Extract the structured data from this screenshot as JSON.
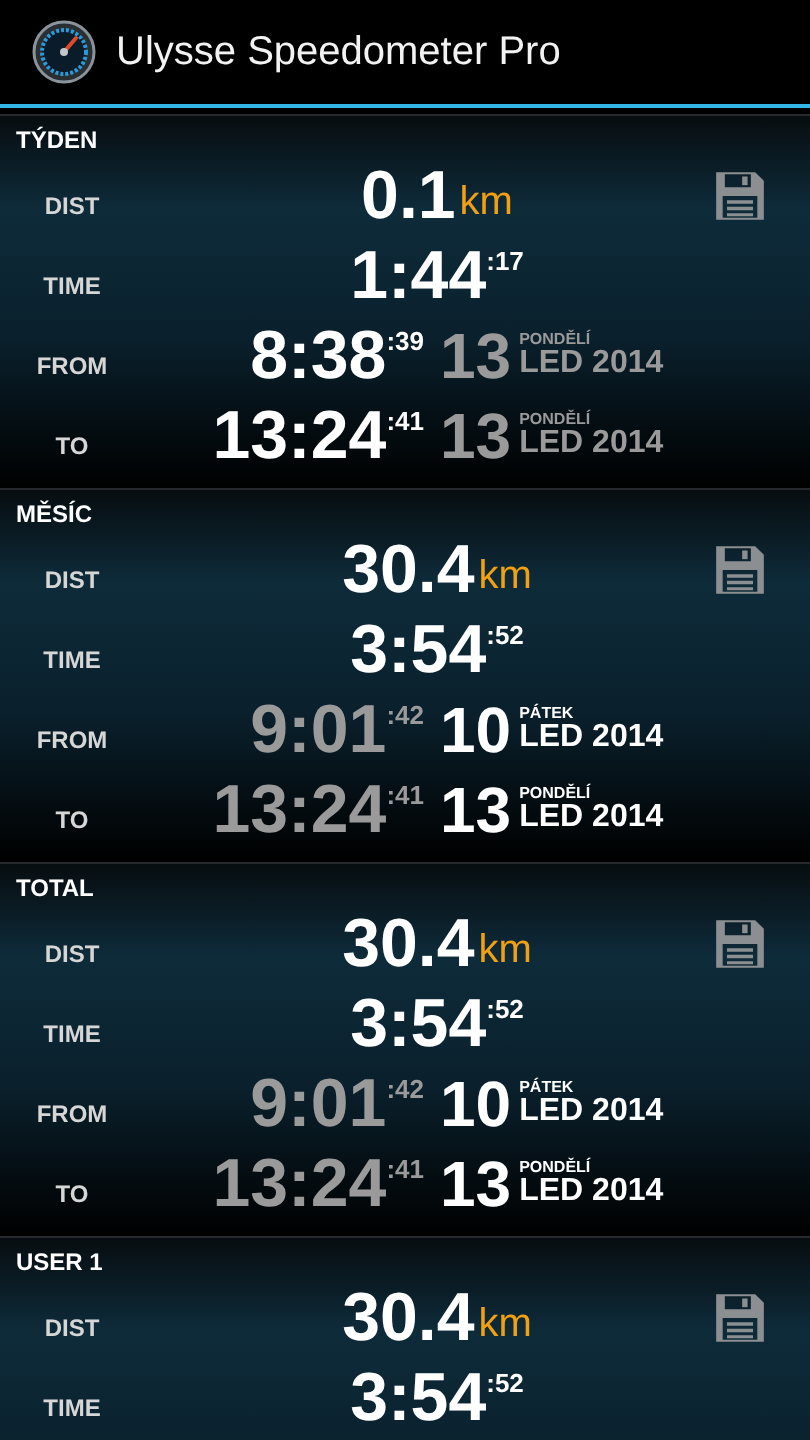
{
  "app_bar": {
    "title": "Ulysse Speedometer Pro"
  },
  "sections": [
    {
      "title": "TÝDEN",
      "dist": {
        "label": "DIST",
        "value": "0.1",
        "unit": "km"
      },
      "time": {
        "label": "TIME",
        "value": "1:44",
        "seconds": ":17"
      },
      "from": {
        "label": "FROM",
        "time": "8:38",
        "seconds": ":39",
        "time_dim": false,
        "day": "13",
        "weekday": "PONDĚLÍ",
        "month_year": "LED 2014",
        "date_dim": true
      },
      "to": {
        "label": "TO",
        "time": "13:24",
        "seconds": ":41",
        "time_dim": false,
        "day": "13",
        "weekday": "PONDĚLÍ",
        "month_year": "LED 2014",
        "date_dim": true
      }
    },
    {
      "title": "MĚSÍC",
      "dist": {
        "label": "DIST",
        "value": "30.4",
        "unit": "km"
      },
      "time": {
        "label": "TIME",
        "value": "3:54",
        "seconds": ":52"
      },
      "from": {
        "label": "FROM",
        "time": "9:01",
        "seconds": ":42",
        "time_dim": true,
        "day": "10",
        "weekday": "PÁTEK",
        "month_year": "LED 2014",
        "date_dim": false
      },
      "to": {
        "label": "TO",
        "time": "13:24",
        "seconds": ":41",
        "time_dim": true,
        "day": "13",
        "weekday": "PONDĚLÍ",
        "month_year": "LED 2014",
        "date_dim": false
      }
    },
    {
      "title": "TOTAL",
      "dist": {
        "label": "DIST",
        "value": "30.4",
        "unit": "km"
      },
      "time": {
        "label": "TIME",
        "value": "3:54",
        "seconds": ":52"
      },
      "from": {
        "label": "FROM",
        "time": "9:01",
        "seconds": ":42",
        "time_dim": true,
        "day": "10",
        "weekday": "PÁTEK",
        "month_year": "LED 2014",
        "date_dim": false
      },
      "to": {
        "label": "TO",
        "time": "13:24",
        "seconds": ":41",
        "time_dim": true,
        "day": "13",
        "weekday": "PONDĚLÍ",
        "month_year": "LED 2014",
        "date_dim": false
      }
    },
    {
      "title": "USER 1",
      "dist": {
        "label": "DIST",
        "value": "30.4",
        "unit": "km"
      },
      "time": {
        "label": "TIME",
        "value": "3:54",
        "seconds": ":52"
      }
    }
  ]
}
